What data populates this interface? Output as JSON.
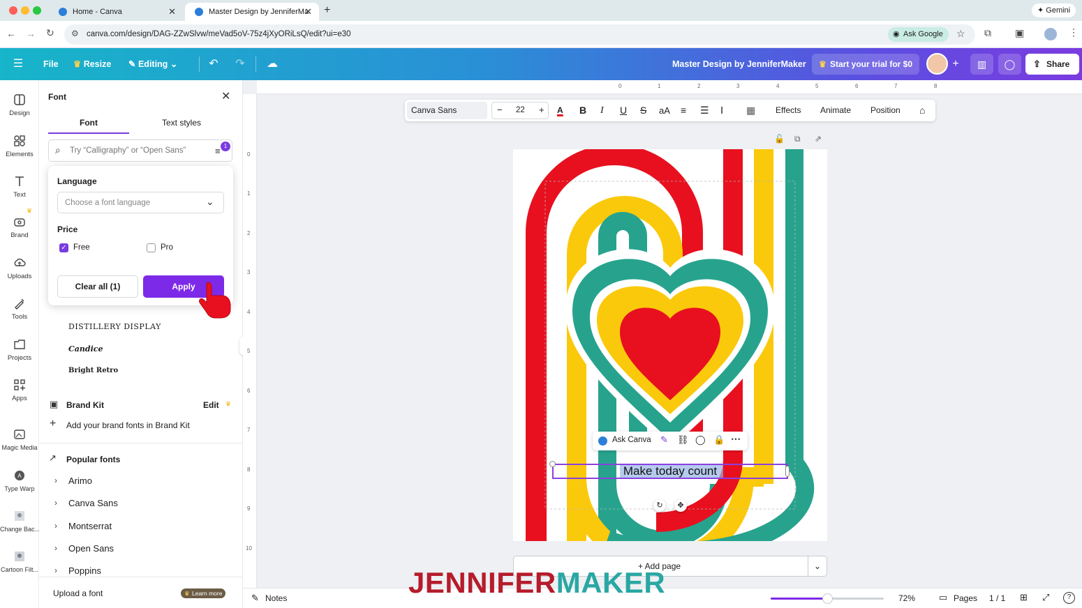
{
  "browser": {
    "tabs": [
      {
        "title": "Home - Canva"
      },
      {
        "title": "Master Design by JenniferMa"
      }
    ],
    "url": "canva.com/design/DAG-ZZwSlvw/meVad5oV-75z4jXyORiLsQ/edit?ui=e30",
    "ask_google": "Ask Google",
    "gemini": "Gemini"
  },
  "header": {
    "file": "File",
    "resize": "Resize",
    "editing": "Editing",
    "doc_title": "Master Design by JenniferMaker",
    "trial": "Start your trial for $0",
    "share": "Share"
  },
  "rail": [
    {
      "label": "Design",
      "icon": "design-icon"
    },
    {
      "label": "Elements",
      "icon": "elements-icon"
    },
    {
      "label": "Text",
      "icon": "text-icon"
    },
    {
      "label": "Brand",
      "icon": "brand-icon"
    },
    {
      "label": "Uploads",
      "icon": "uploads-icon"
    },
    {
      "label": "Tools",
      "icon": "tools-icon"
    },
    {
      "label": "Projects",
      "icon": "projects-icon"
    },
    {
      "label": "Apps",
      "icon": "apps-icon"
    },
    {
      "label": "Magic Media",
      "icon": "magic-media-icon"
    },
    {
      "label": "Type Warp",
      "icon": "type-warp-icon"
    },
    {
      "label": "Change Bac...",
      "icon": "change-background-icon"
    },
    {
      "label": "Cartoon Filt...",
      "icon": "cartoon-filter-icon"
    }
  ],
  "panel": {
    "title": "Font",
    "tabs": [
      "Font",
      "Text styles"
    ],
    "search_placeholder": "Try “Calligraphy” or “Open Sans”",
    "filter_count": "1",
    "filter": {
      "language_label": "Language",
      "language_placeholder": "Choose a font language",
      "price_label": "Price",
      "free": "Free",
      "pro": "Pro",
      "clear": "Clear all (1)",
      "apply": "Apply"
    },
    "font_samples": [
      "DISTILLERY DISPLAY",
      "Candice",
      "Bright Retro"
    ],
    "brand_kit": "Brand Kit",
    "brand_edit": "Edit",
    "brand_add": "Add your brand fonts in Brand Kit",
    "popular": "Popular fonts",
    "popular_fonts": [
      "Arimo",
      "Canva Sans",
      "Montserrat",
      "Open Sans",
      "Poppins"
    ],
    "upload": "Upload a font",
    "learn_more": "Learn more"
  },
  "toolbar": {
    "font_name": "Canva Sans",
    "font_size": "22",
    "effects": "Effects",
    "animate": "Animate",
    "position": "Position"
  },
  "ruler": {
    "top": [
      "0",
      "1",
      "2",
      "3",
      "4",
      "5",
      "6",
      "7",
      "8"
    ],
    "left": [
      "0",
      "1",
      "2",
      "3",
      "4",
      "5",
      "6",
      "7",
      "8",
      "9",
      "10"
    ]
  },
  "canvas": {
    "text": "Make today count",
    "ask_canva": "Ask Canva",
    "colors": {
      "red": "#e8101f",
      "yellow": "#fbc90b",
      "teal": "#27a38d"
    }
  },
  "bottom": {
    "add_page": "+ Add page",
    "notes": "Notes",
    "zoom": "72%",
    "pages": "Pages",
    "page_count": "1 / 1"
  },
  "watermark": {
    "part1": "JENNIFER",
    "part2": "MAKER"
  }
}
